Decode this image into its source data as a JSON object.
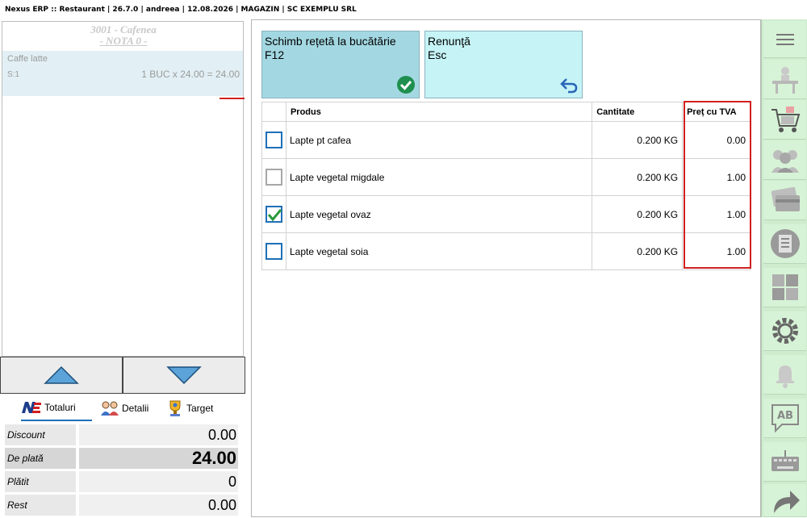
{
  "titlebar": "Nexus ERP :: Restaurant  |  26.7.0  |  andreea  |  12.08.2026  |  MAGAZIN  |  SC EXEMPLU SRL",
  "order": {
    "table": "3001 - Cafenea",
    "note": "- NOTA 0 -",
    "item": {
      "name": "Caffe latte",
      "s": "S:1",
      "calc": "1 BUC x 24.00 = 24.00"
    }
  },
  "tabs": {
    "totals": "Totaluri",
    "details": "Detalii",
    "target": "Target"
  },
  "totals": {
    "discount_label": "Discount",
    "discount_value": "0.00",
    "topay_label": "De plată",
    "topay_value": "24.00",
    "paid_label": "Plătit",
    "paid_value": "0",
    "rest_label": "Rest",
    "rest_value": "0.00"
  },
  "actions": {
    "change_line1": "Schimb rețetă la bucătărie",
    "change_line2": "F12",
    "cancel_line1": "Renunţă",
    "cancel_line2": "Esc"
  },
  "grid": {
    "headers": {
      "product": "Produs",
      "qty": "Cantitate",
      "price": "Preț cu TVA"
    },
    "rows": [
      {
        "product": "Lapte pt cafea",
        "qty": "0.200 KG",
        "price": "0.00",
        "checked": false
      },
      {
        "product": "Lapte vegetal migdale",
        "qty": "0.200 KG",
        "price": "1.00",
        "checked": false
      },
      {
        "product": "Lapte vegetal ovaz",
        "qty": "0.200 KG",
        "price": "1.00",
        "checked": true
      },
      {
        "product": "Lapte vegetal soia",
        "qty": "0.200 KG",
        "price": "1.00",
        "checked": false
      }
    ]
  },
  "sidebar": {
    "icons": [
      "menu-icon",
      "table-service-icon",
      "cart-icon",
      "customers-icon",
      "payment-card-icon",
      "receipt-icon",
      "puzzle-icon",
      "settings-icon",
      "bell-icon",
      "language-ab-icon",
      "keyboard-icon",
      "forward-icon"
    ]
  },
  "colors": {
    "accent": "#1f6fb8",
    "highlight": "#d21f1f",
    "confirm": "#1f8f4f",
    "sidebar": "#cfeccf"
  }
}
